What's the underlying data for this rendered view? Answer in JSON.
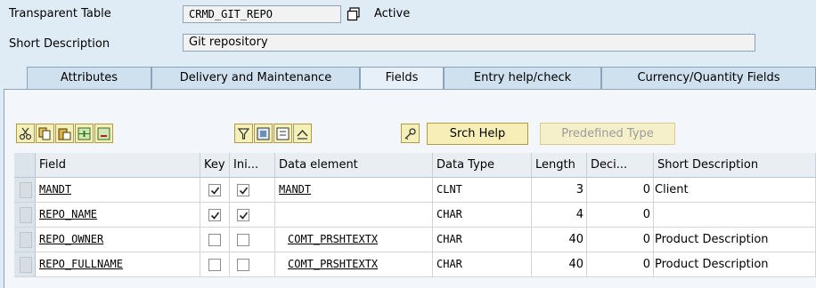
{
  "header": {
    "table_type_label": "Transparent Table",
    "table_name": "CRMD_GIT_REPO",
    "status": "Active",
    "short_desc_label": "Short Description",
    "short_desc_value": "Git repository"
  },
  "tabs": [
    {
      "label": "Attributes"
    },
    {
      "label": "Delivery and Maintenance"
    },
    {
      "label": "Fields"
    },
    {
      "label": "Entry help/check"
    },
    {
      "label": "Currency/Quantity Fields"
    }
  ],
  "toolbar": {
    "srch_help": "Srch Help",
    "predefined_type": "Predefined Type"
  },
  "columns": [
    "Field",
    "Key",
    "Ini...",
    "Data element",
    "Data Type",
    "Length",
    "Deci...",
    "Short Description"
  ],
  "rows": [
    {
      "field": "MANDT",
      "key": true,
      "init": true,
      "data_element": "MANDT",
      "data_type": "CLNT",
      "length": "3",
      "decimals": "0",
      "short_desc": "Client"
    },
    {
      "field": "REPO_NAME",
      "key": true,
      "init": true,
      "data_element": "",
      "data_type": "CHAR",
      "length": "4",
      "decimals": "0",
      "short_desc": ""
    },
    {
      "field": "REPO_OWNER",
      "key": false,
      "init": false,
      "data_element": "COMT_PRSHTEXTX",
      "data_type": "CHAR",
      "length": "40",
      "decimals": "0",
      "short_desc": "Product Description"
    },
    {
      "field": "REPO_FULLNAME",
      "key": false,
      "init": false,
      "data_element": "COMT_PRSHTEXTX",
      "data_type": "CHAR",
      "length": "40",
      "decimals": "0",
      "short_desc": "Product Description"
    }
  ],
  "colors": {
    "background": "#dfebf5",
    "button_fill": "#f6eeb6",
    "tab_fill": "#cfe0ee"
  }
}
